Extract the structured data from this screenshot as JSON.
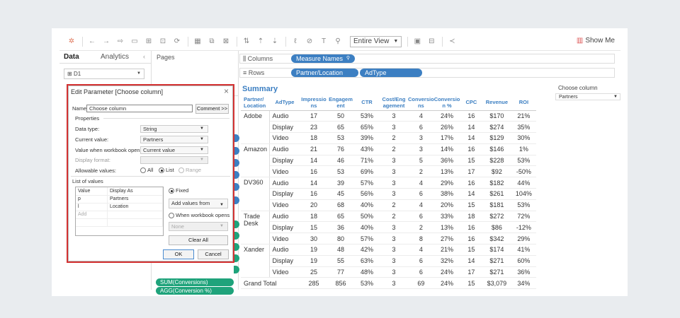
{
  "toolbar": {
    "view_select": "Entire View",
    "show_me": "Show Me"
  },
  "left_panel": {
    "tab_data": "Data",
    "tab_analytics": "Analytics",
    "datasource": "D1"
  },
  "pages_label": "Pages",
  "side_pills": [
    "SUM(Conversions)",
    "AGG(Conversion %)"
  ],
  "shelves": {
    "columns_label": "Columns",
    "columns_pills": [
      "Measure Names"
    ],
    "rows_label": "Rows",
    "rows_pills": [
      "Partner/Location",
      "AdType"
    ]
  },
  "summary": {
    "title": "Summary",
    "headers": [
      "Partner/ Location",
      "AdType",
      "Impressio ns",
      "Engagem ent",
      "CTR",
      "Cost/Eng agement",
      "Conversio ns",
      "Conversio n %",
      "CPC",
      "Revenue",
      "ROI"
    ],
    "rows": [
      [
        "Adobe",
        "Audio",
        "17",
        "50",
        "53%",
        "3",
        "4",
        "24%",
        "16",
        "$170",
        "21%"
      ],
      [
        "",
        "Display",
        "23",
        "65",
        "65%",
        "3",
        "6",
        "26%",
        "14",
        "$274",
        "35%"
      ],
      [
        "",
        "Video",
        "18",
        "53",
        "39%",
        "2",
        "3",
        "17%",
        "14",
        "$129",
        "30%"
      ],
      [
        "Amazon",
        "Audio",
        "21",
        "76",
        "43%",
        "2",
        "3",
        "14%",
        "16",
        "$146",
        "1%"
      ],
      [
        "",
        "Display",
        "14",
        "46",
        "71%",
        "3",
        "5",
        "36%",
        "15",
        "$228",
        "53%"
      ],
      [
        "",
        "Video",
        "16",
        "53",
        "69%",
        "3",
        "2",
        "13%",
        "17",
        "$92",
        "-50%"
      ],
      [
        "DV360",
        "Audio",
        "14",
        "39",
        "57%",
        "3",
        "4",
        "29%",
        "16",
        "$182",
        "44%"
      ],
      [
        "",
        "Display",
        "16",
        "45",
        "56%",
        "3",
        "6",
        "38%",
        "14",
        "$261",
        "104%"
      ],
      [
        "",
        "Video",
        "20",
        "68",
        "40%",
        "2",
        "4",
        "20%",
        "15",
        "$181",
        "53%"
      ],
      [
        "Trade Desk",
        "Audio",
        "18",
        "65",
        "50%",
        "2",
        "6",
        "33%",
        "18",
        "$272",
        "72%"
      ],
      [
        "",
        "Display",
        "15",
        "36",
        "40%",
        "3",
        "2",
        "13%",
        "16",
        "$86",
        "-12%"
      ],
      [
        "",
        "Video",
        "30",
        "80",
        "57%",
        "3",
        "8",
        "27%",
        "16",
        "$342",
        "29%"
      ],
      [
        "Xander",
        "Audio",
        "19",
        "48",
        "42%",
        "3",
        "4",
        "21%",
        "15",
        "$174",
        "41%"
      ],
      [
        "",
        "Display",
        "19",
        "55",
        "63%",
        "3",
        "6",
        "32%",
        "14",
        "$271",
        "60%"
      ],
      [
        "",
        "Video",
        "25",
        "77",
        "48%",
        "3",
        "6",
        "24%",
        "17",
        "$271",
        "36%"
      ]
    ],
    "grand_total": [
      "Grand Total",
      "285",
      "856",
      "53%",
      "3",
      "69",
      "24%",
      "15",
      "$3,079",
      "34%"
    ]
  },
  "right_panel": {
    "title": "Choose column",
    "value": "Partners"
  },
  "dialog": {
    "title": "Edit Parameter [Choose column]",
    "name_label": "Name:",
    "name_value": "Choose column",
    "comment_button": "Comment >>",
    "properties_label": "Properties",
    "data_type_label": "Data type:",
    "data_type_value": "String",
    "current_value_label": "Current value:",
    "current_value": "Partners",
    "workbook_opens_label": "Value when workbook opens:",
    "workbook_opens_value": "Current value",
    "display_format_label": "Display format:",
    "allowable_label": "Allowable values:",
    "allowable_options": [
      "All",
      "List",
      "Range"
    ],
    "allowable_selected": "List",
    "list_label": "List of values",
    "list_headers": [
      "Value",
      "Display As"
    ],
    "list_rows": [
      [
        "p",
        "Partners"
      ],
      [
        "l",
        "Location"
      ]
    ],
    "list_add": "Add",
    "fixed_label": "Fixed",
    "add_values_from": "Add values from",
    "when_opens_label": "When workbook opens",
    "none_label": "None",
    "clear_all": "Clear All",
    "ok": "OK",
    "cancel": "Cancel"
  }
}
